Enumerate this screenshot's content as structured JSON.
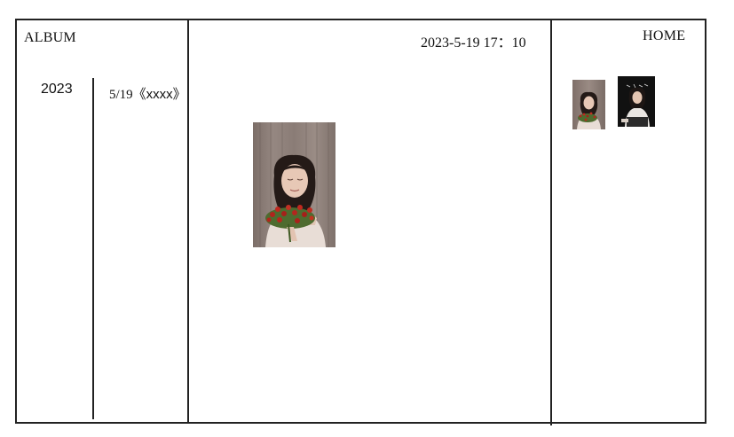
{
  "sidebar": {
    "title": "ALBUM",
    "years": [
      {
        "label": "2023"
      }
    ],
    "entries": [
      {
        "label": "5/19",
        "title": "《xxxx》"
      }
    ]
  },
  "main": {
    "datetime": "2023-5-19 17：10",
    "photo_icon": "portrait-photo"
  },
  "right_panel": {
    "home_label": "HOME",
    "thumbnails": [
      {
        "icon": "portrait-with-flowers-thumbnail"
      },
      {
        "icon": "portrait-dark-background-thumbnail"
      }
    ]
  }
}
